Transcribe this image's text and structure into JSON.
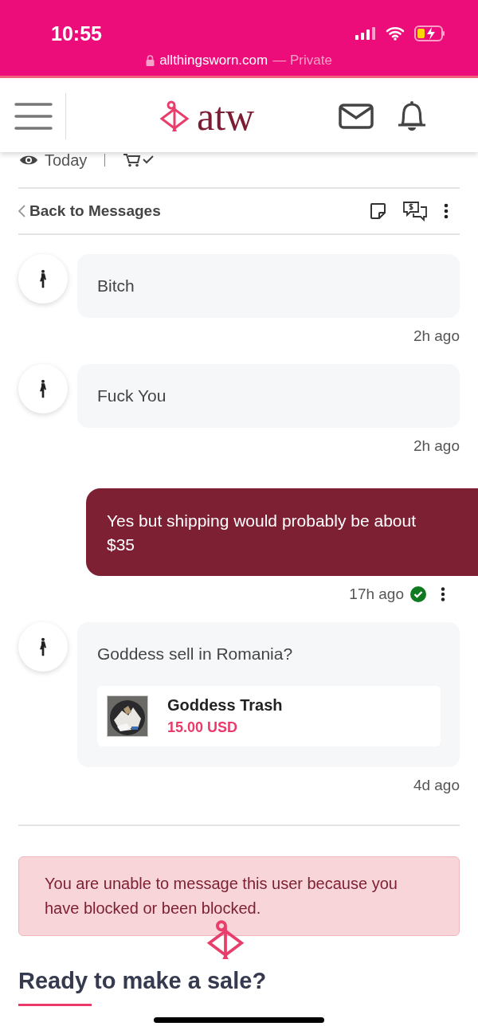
{
  "status_bar": {
    "time": "10:55",
    "url": "allthingsworn.com",
    "mode": "— Private"
  },
  "header": {
    "logo": "atw"
  },
  "listing_meta": {
    "views": "Today"
  },
  "thread_bar": {
    "back": "Back to Messages"
  },
  "messages": [
    {
      "kind": "incoming",
      "text": "Bitch",
      "time": "2h ago"
    },
    {
      "kind": "incoming",
      "text": "Fuck You",
      "time": "2h ago"
    },
    {
      "kind": "outgoing",
      "text": "Yes but shipping would probably be about $35",
      "time": "17h ago",
      "read": true
    },
    {
      "kind": "incoming",
      "text": "Goddess sell in Romania?",
      "time": "4d ago",
      "product": {
        "kind": "picture",
        "title": "Goddess Trash",
        "price": "15.00 USD"
      }
    }
  ],
  "alert": "You are unable to message this user because you have blocked or been blocked.",
  "section_heading": "Ready to make a sale?"
}
